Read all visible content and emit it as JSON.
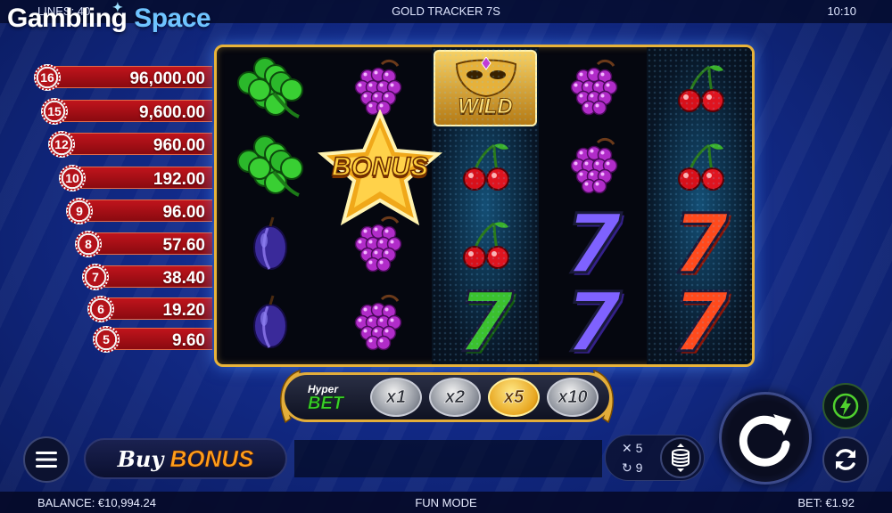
{
  "top_bar": {
    "lines": "LINES: 40",
    "title": "GOLD TRACKER 7S",
    "clock": "10:10"
  },
  "brand": {
    "word1": "Gambling",
    "word2": "Space"
  },
  "paytable": [
    {
      "count": "16",
      "value": "96,000.00"
    },
    {
      "count": "15",
      "value": "9,600.00"
    },
    {
      "count": "12",
      "value": "960.00"
    },
    {
      "count": "10",
      "value": "192.00"
    },
    {
      "count": "9",
      "value": "96.00"
    },
    {
      "count": "8",
      "value": "57.60"
    },
    {
      "count": "7",
      "value": "38.40"
    },
    {
      "count": "6",
      "value": "19.20"
    },
    {
      "count": "5",
      "value": "9.60"
    }
  ],
  "reels": {
    "symbol_legend": [
      "clover",
      "grapes",
      "plum",
      "cherries",
      "seven-red",
      "seven-purple",
      "seven-green",
      "wild",
      "bonus"
    ],
    "columns": [
      [
        "clover",
        "clover",
        "plum",
        "plum"
      ],
      [
        "grapes",
        "bonus",
        "grapes",
        "grapes"
      ],
      [
        "wild",
        "cherries",
        "cherries",
        "seven-green"
      ],
      [
        "grapes",
        "grapes",
        "seven-purple",
        "seven-purple"
      ],
      [
        "cherries",
        "cherries",
        "seven-red",
        "seven-red"
      ]
    ],
    "wild_label": "WILD",
    "bonus_label": "BONUS"
  },
  "hyper_bet": {
    "label_top": "Hyper",
    "label_bottom": "BET",
    "multipliers": [
      {
        "label": "x1",
        "active": false
      },
      {
        "label": "x2",
        "active": false
      },
      {
        "label": "x5",
        "active": true
      },
      {
        "label": "x10",
        "active": false
      }
    ]
  },
  "controls": {
    "buy_word": "Buy",
    "bonus_word": "BONUS",
    "auto_multiplier": "5",
    "auto_spins": "9"
  },
  "bottom_bar": {
    "balance": "BALANCE: €10,994.24",
    "mode": "FUN MODE",
    "bet": "BET: €1.92"
  },
  "colors": {
    "gold_frame": "#e8b33a",
    "paytable_red": "#c0141c",
    "hyper_green": "#39d12a",
    "active_gold": "#e7a51f"
  },
  "icons": [
    "menu-icon",
    "coin-stack-icon",
    "spin-arrow-icon",
    "lightning-icon",
    "autoplay-icon",
    "multiply-icon",
    "repeat-icon"
  ]
}
